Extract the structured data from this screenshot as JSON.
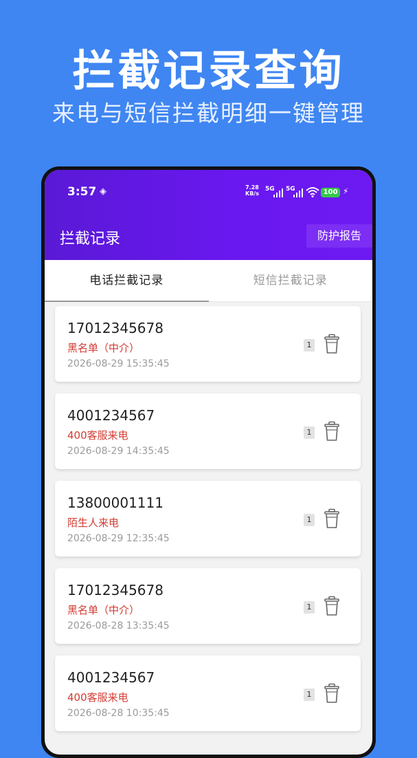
{
  "promo": {
    "title": "拦截记录查询",
    "subtitle": "来电与短信拦截明细一键管理"
  },
  "status_bar": {
    "time": "3:57",
    "net_speed": "7.28",
    "net_unit": "KB/s",
    "sim1": "5G",
    "sim2": "5G",
    "battery": "100"
  },
  "app_bar": {
    "title": "拦截记录",
    "report_button": "防护报告"
  },
  "tabs": [
    {
      "label": "电话拦截记录",
      "active": true
    },
    {
      "label": "短信拦截记录",
      "active": false
    }
  ],
  "records": [
    {
      "number": "17012345678",
      "tag": "黑名单（中介）",
      "time": "2026-08-29 15:35:45",
      "count": "1"
    },
    {
      "number": "4001234567",
      "tag": "400客服来电",
      "time": "2026-08-29 14:35:45",
      "count": "1"
    },
    {
      "number": "13800001111",
      "tag": "陌生人来电",
      "time": "2026-08-29 12:35:45",
      "count": "1"
    },
    {
      "number": "17012345678",
      "tag": "黑名单（中介）",
      "time": "2026-08-28 13:35:45",
      "count": "1"
    },
    {
      "number": "4001234567",
      "tag": "400客服来电",
      "time": "2026-08-28 10:35:45",
      "count": "1"
    }
  ],
  "colors": {
    "background": "#3f86f2",
    "app_bar": "#6a18f0",
    "tag": "#d33b32",
    "battery": "#35c84a"
  }
}
